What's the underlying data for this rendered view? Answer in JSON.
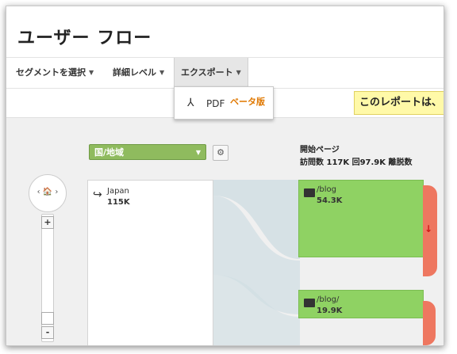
{
  "page": {
    "title": "ユーザー フロー"
  },
  "toolbar": {
    "segment_label": "セグメントを選択",
    "detail_label": "詳細レベル",
    "export_label": "エクスポート"
  },
  "export_menu": {
    "pdf_label": "PDF",
    "beta_label": "ベータ版"
  },
  "notice": {
    "text": "このレポートは、"
  },
  "controls": {
    "dimension_select": "国/地域",
    "nav_label": "‹ 🏠 ›"
  },
  "start_page": {
    "title": "開始ページ",
    "stats": "訪問数 117K 回97.9K 離脱数"
  },
  "country_node": {
    "name": "Japan",
    "value": "115K"
  },
  "page_nodes": [
    {
      "name": "/blog",
      "value": "54.3K"
    },
    {
      "name": "/blog/",
      "value": "19.9K"
    }
  ],
  "colors": {
    "node_green": "#8fd263",
    "dropoff_red": "#ee7760",
    "notice_yellow": "#fff9a8",
    "beta_orange": "#e07800"
  }
}
